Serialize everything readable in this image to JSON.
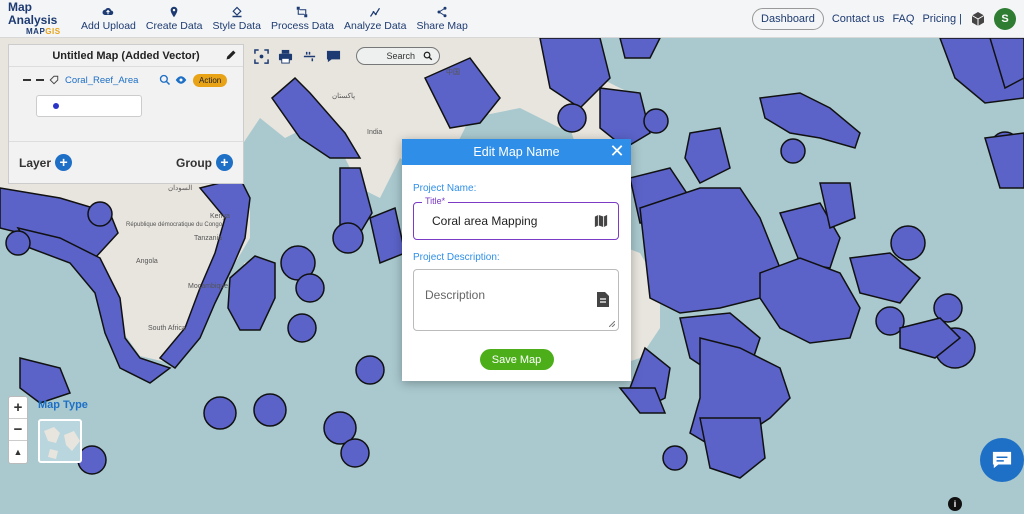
{
  "app": {
    "logo_title": "Map Analysis",
    "logo_sub_a": "MAP",
    "logo_sub_b": "GIS"
  },
  "nav": {
    "items": [
      {
        "label": "Add Upload",
        "icon": "cloud-upload-icon"
      },
      {
        "label": "Create Data",
        "icon": "location-pin-icon"
      },
      {
        "label": "Style Data",
        "icon": "paint-bucket-icon"
      },
      {
        "label": "Process Data",
        "icon": "process-nodes-icon"
      },
      {
        "label": "Analyze Data",
        "icon": "analyze-chart-icon"
      },
      {
        "label": "Share Map",
        "icon": "share-icon"
      }
    ],
    "dashboard": "Dashboard",
    "contact": "Contact us",
    "faq": "FAQ",
    "pricing": "Pricing |",
    "avatar_initial": "S"
  },
  "layer_panel": {
    "title": "Untitled Map (Added Vector)",
    "layer_name": "Coral_Reef_Area",
    "action_label": "Action",
    "layer_label": "Layer",
    "group_label": "Group"
  },
  "map_toolbar": {
    "search_label": "Search"
  },
  "map": {
    "map_type_label": "Map Type",
    "labels": [
      {
        "text": "India"
      },
      {
        "text": "پاکستان"
      },
      {
        "text": "中国"
      },
      {
        "text": "Kenya"
      },
      {
        "text": "Tanzania"
      },
      {
        "text": "Angola"
      },
      {
        "text": "République démocratique du Congo"
      },
      {
        "text": "South Africa"
      },
      {
        "text": "Moçambique"
      },
      {
        "text": "السودان"
      }
    ],
    "overlay_color": "#5b63c9",
    "land_color": "#e8e5de",
    "sea_color": "#a9c9cf"
  },
  "modal": {
    "title": "Edit Map Name",
    "project_name_label": "Project Name:",
    "title_field_label": "Title*",
    "title_value": "Coral area Mapping",
    "description_label": "Project Description:",
    "description_placeholder": "Description",
    "save_label": "Save Map",
    "header_color": "#2f8fe8",
    "save_color": "#4caf1a"
  }
}
